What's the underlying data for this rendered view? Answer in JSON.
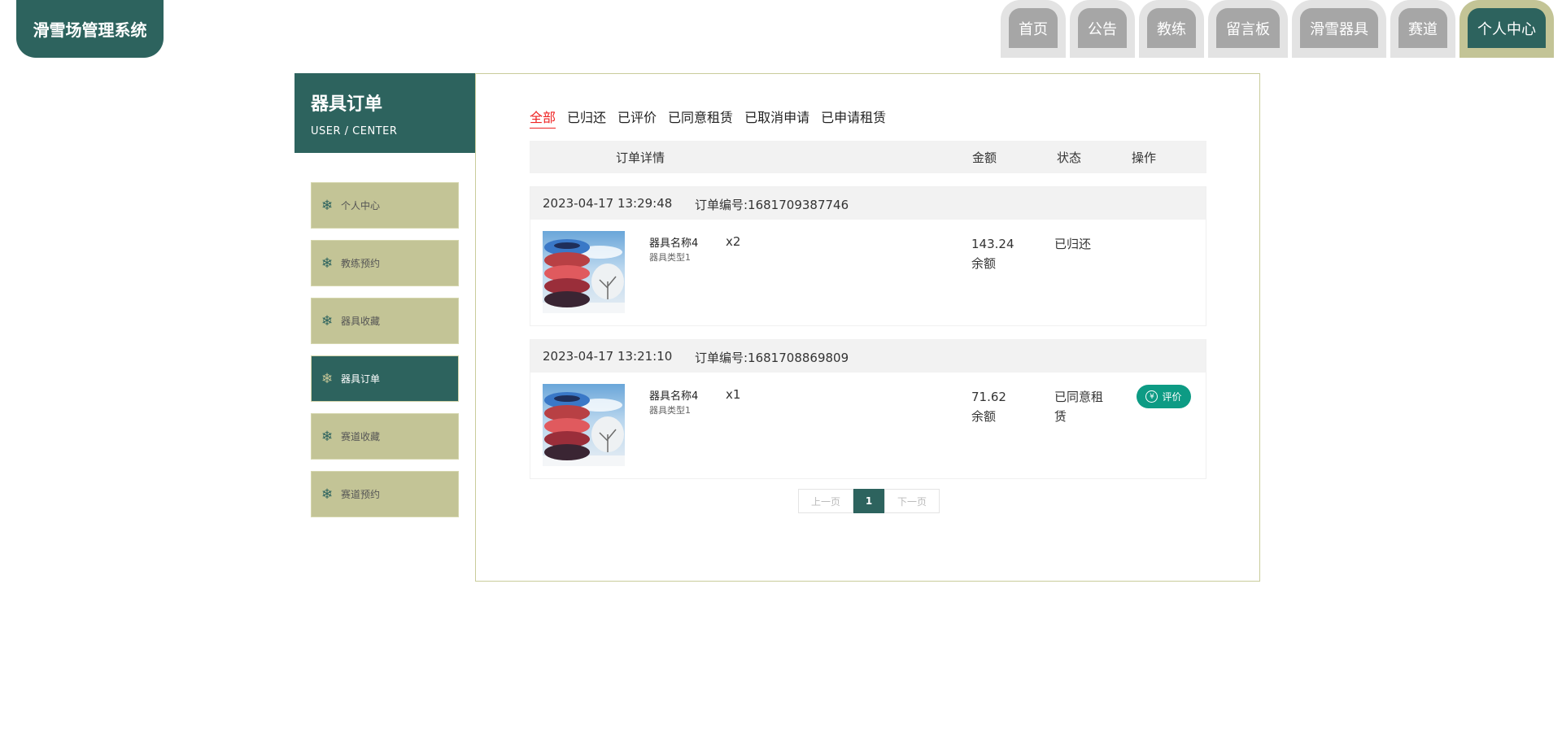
{
  "app_title": "滑雪场管理系统",
  "nav": [
    {
      "label": "首页",
      "active": false
    },
    {
      "label": "公告",
      "active": false
    },
    {
      "label": "教练",
      "active": false
    },
    {
      "label": "留言板",
      "active": false
    },
    {
      "label": "滑雪器具",
      "active": false
    },
    {
      "label": "赛道",
      "active": false
    },
    {
      "label": "个人中心",
      "active": true
    }
  ],
  "sidebar": {
    "title": "器具订单",
    "subtitle": "USER / CENTER",
    "items": [
      {
        "label": "个人中心",
        "icon": "snowflake-icon",
        "active": false
      },
      {
        "label": "教练预约",
        "icon": "snowflake-icon",
        "active": false
      },
      {
        "label": "器具收藏",
        "icon": "snowflake-icon",
        "active": false
      },
      {
        "label": "器具订单",
        "icon": "snowflake-icon",
        "active": true
      },
      {
        "label": "赛道收藏",
        "icon": "snowflake-icon",
        "active": false
      },
      {
        "label": "赛道预约",
        "icon": "snowflake-icon",
        "active": false
      }
    ]
  },
  "filters": [
    {
      "label": "全部",
      "active": true
    },
    {
      "label": "已归还",
      "active": false
    },
    {
      "label": "已评价",
      "active": false
    },
    {
      "label": "已同意租赁",
      "active": false
    },
    {
      "label": "已取消申请",
      "active": false
    },
    {
      "label": "已申请租赁",
      "active": false
    }
  ],
  "table_headers": {
    "detail": "订单详情",
    "amount": "金额",
    "status": "状态",
    "action": "操作"
  },
  "orders": [
    {
      "time": "2023-04-17 13:29:48",
      "order_no": "订单编号:1681709387746",
      "item_name": "器具名称4",
      "item_type": "器具类型1",
      "qty": "x2",
      "amount": "143.24",
      "amount_unit": "余额",
      "status": "已归还",
      "action": ""
    },
    {
      "time": "2023-04-17 13:21:10",
      "order_no": "订单编号:1681708869809",
      "item_name": "器具名称4",
      "item_type": "器具类型1",
      "qty": "x1",
      "amount": "71.62",
      "amount_unit": "余额",
      "status": "已同意租赁",
      "action": "评价"
    }
  ],
  "pager": {
    "prev": "上一页",
    "current": "1",
    "next": "下一页"
  },
  "colors": {
    "primary": "#2d635e",
    "khaki": "#c3c496",
    "accent_red": "#e22222",
    "action_green": "#0d9b84"
  }
}
